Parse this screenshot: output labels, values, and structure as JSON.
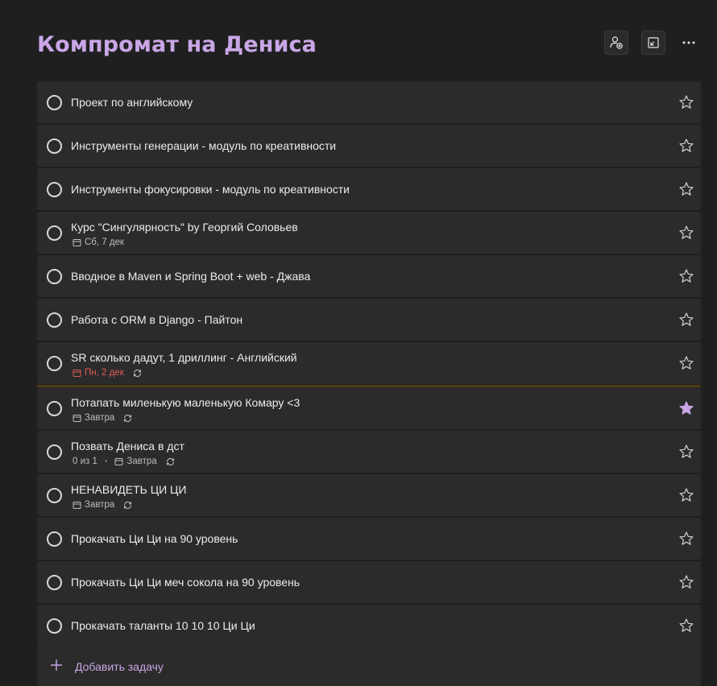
{
  "list": {
    "title": "Компромат на Дениса",
    "accent": "#c9a6e6",
    "header_buttons": [
      "share-list",
      "expand",
      "more-options"
    ]
  },
  "tasks": [
    {
      "title": "Проект по английскому",
      "starred": false
    },
    {
      "title": "Инструменты генерации - модуль по креативности",
      "starred": false
    },
    {
      "title": "Инструменты фокусировки - модуль по креативности",
      "starred": false
    },
    {
      "title": "Курс \"Сингулярность\" by Георгий Соловьев",
      "starred": false,
      "due": "Сб, 7 дек"
    },
    {
      "title": "Вводное в Maven и Spring Boot + web - Джава",
      "starred": false
    },
    {
      "title": "Работа с ORM в Django - Пайтон",
      "starred": false
    },
    {
      "title": "SR сколько дадут, 1 дриллинг - Английский",
      "starred": false,
      "due": "Пн, 2 дек",
      "overdue": true,
      "repeat": true
    },
    {
      "title": "Потапать миленькую маленькую Комару <3",
      "starred": true,
      "due": "Завтра",
      "repeat": true
    },
    {
      "title": "Позвать Дениса в дст",
      "starred": false,
      "steps": "0 из 1",
      "due": "Завтра",
      "repeat": true
    },
    {
      "title": "НЕНАВИДЕТЬ ЦИ ЦИ",
      "starred": false,
      "due": "Завтра",
      "repeat": true
    },
    {
      "title": "Прокачать Ци Ци на 90 уровень",
      "starred": false
    },
    {
      "title": "Прокачать Ци Ци меч сокола на 90 уровень",
      "starred": false
    },
    {
      "title": "Прокачать таланты 10 10 10 Ци Ци",
      "starred": false
    }
  ],
  "add_task": {
    "label": "Добавить задачу"
  }
}
